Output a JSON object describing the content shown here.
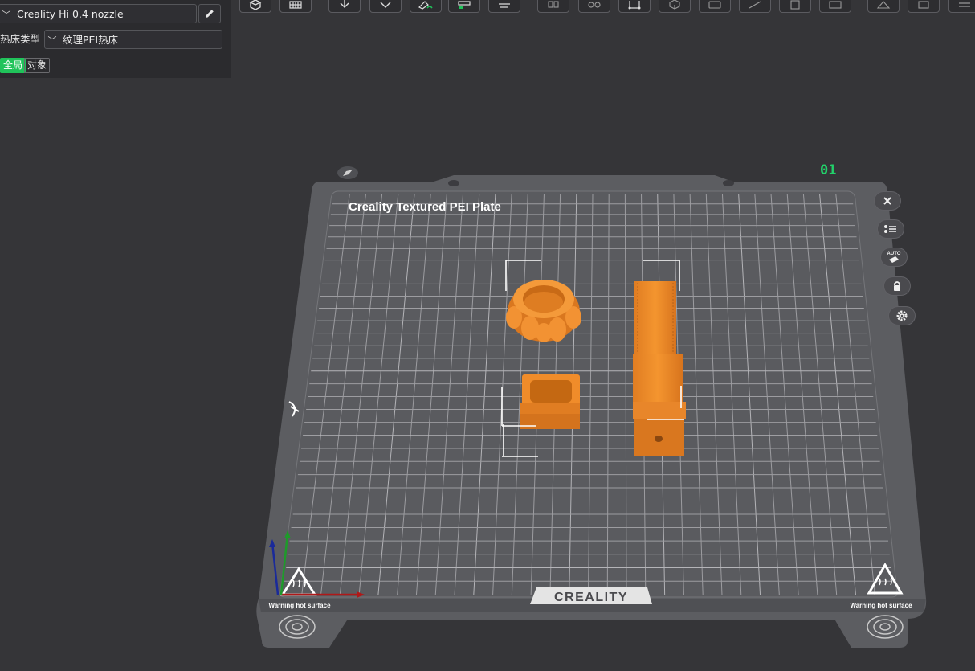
{
  "left_panel": {
    "printer": "Creality Hi 0.4 nozzle",
    "bed_type_label": "热床类型",
    "bed_type": "纹理PEI热床",
    "tab_global": "全局",
    "tab_object": "对象"
  },
  "toolbar": {
    "icons": [
      "add-cube-icon",
      "grid-icon",
      "orient-icon",
      "arrange-icon",
      "paint-icon",
      "split-icon",
      "layer-icon",
      "box-icon",
      "gear-pair-icon",
      "crop-icon",
      "cube-outline-icon",
      "camera-icon",
      "measure-icon",
      "square-icon",
      "keyboard-icon",
      "slope-icon",
      "export-icon",
      "menu-icon"
    ]
  },
  "plate": {
    "title": "Creality Textured PEI Plate",
    "brand": "CREALITY",
    "number": "01",
    "warning_left": "Warning hot surface",
    "warning_right": "Warning hot surface"
  },
  "side_buttons": {
    "icons": [
      "close-icon",
      "list-icon",
      "auto-icon",
      "lock-icon",
      "settings-icon"
    ],
    "auto_label": "AUTO"
  },
  "colors": {
    "accent": "#20c35a",
    "model": "#f08c2a",
    "plate": "#5c5d61",
    "grid": "#9c9ca0"
  }
}
